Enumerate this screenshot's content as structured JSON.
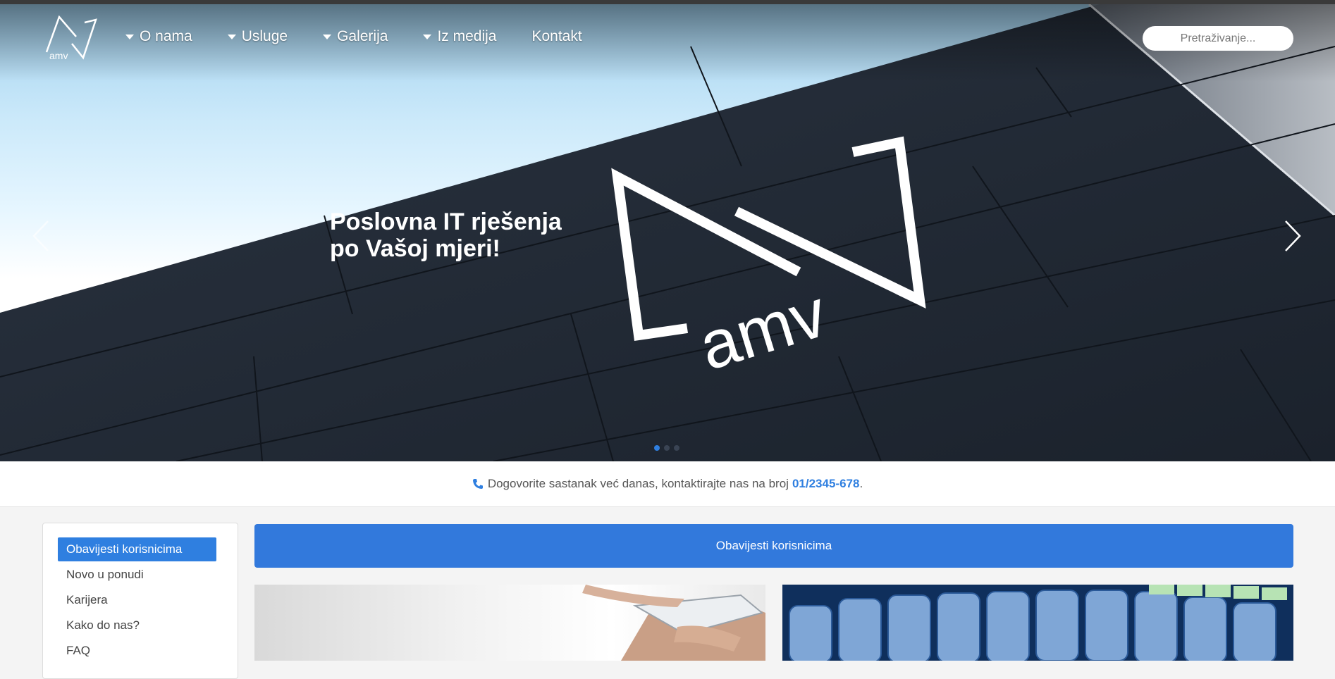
{
  "nav": {
    "logo_text": "amv",
    "items": [
      {
        "label": "O nama",
        "has_dropdown": true
      },
      {
        "label": "Usluge",
        "has_dropdown": true
      },
      {
        "label": "Galerija",
        "has_dropdown": true
      },
      {
        "label": "Iz medija",
        "has_dropdown": true
      },
      {
        "label": "Kontakt",
        "has_dropdown": false
      }
    ],
    "search_placeholder": "Pretraživanje..."
  },
  "hero": {
    "headline_line1": "Poslovna IT rješenja",
    "headline_line2": "po Vašoj mjeri!",
    "logo_text": "amv",
    "slides": 3,
    "active_slide": 1
  },
  "contact": {
    "text": "Dogovorite sastanak već danas, kontaktirajte nas na broj",
    "phone": "01/2345-678",
    "suffix": "."
  },
  "sidebar": {
    "items": [
      {
        "label": "Obavijesti korisnicima",
        "active": true
      },
      {
        "label": "Novo u ponudi",
        "active": false
      },
      {
        "label": "Karijera",
        "active": false
      },
      {
        "label": "Kako do nas?",
        "active": false
      },
      {
        "label": "FAQ",
        "active": false
      }
    ]
  },
  "main": {
    "banner_title": "Obavijesti korisnicima",
    "cards": [
      {
        "image": "smartphone-hands-photo"
      },
      {
        "image": "network-cables-photo"
      }
    ]
  },
  "colors": {
    "accent": "#2f7fe0",
    "banner": "#3279dc",
    "hero_dark": "#232b37"
  }
}
